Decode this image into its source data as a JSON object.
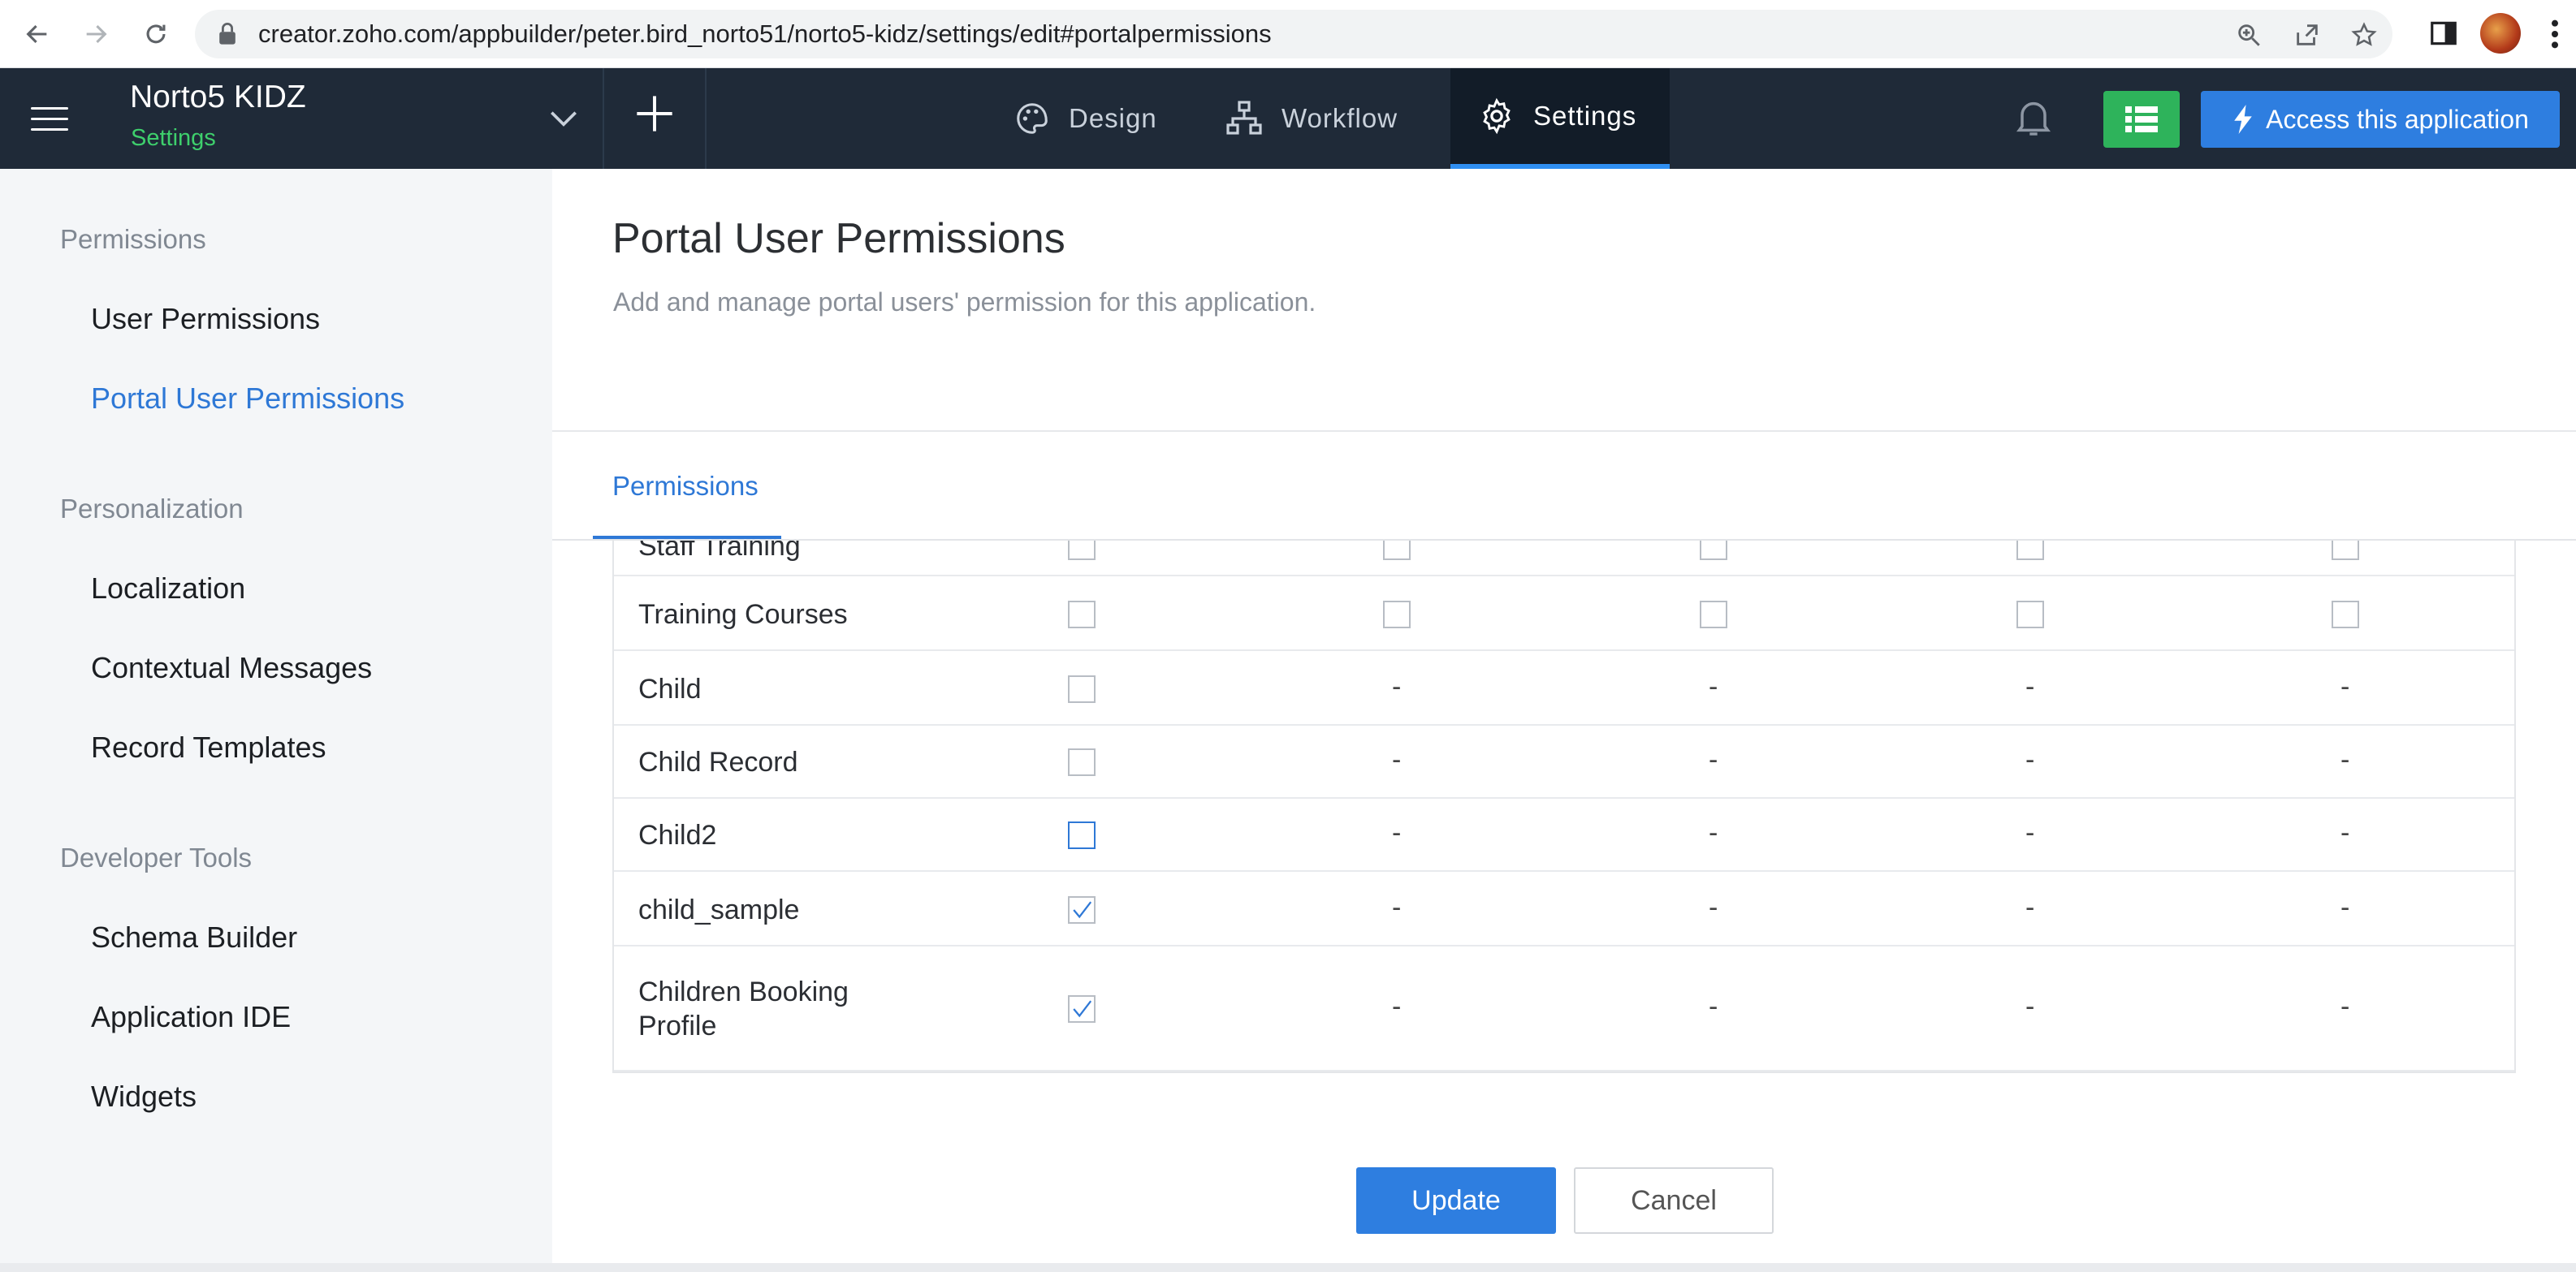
{
  "browser": {
    "url": "creator.zoho.com/appbuilder/peter.bird_norto51/norto5-kidz/settings/edit#portalpermissions"
  },
  "header": {
    "app_name": "Norto5 KIDZ",
    "app_section": "Settings",
    "tabs": [
      {
        "label": "Design",
        "icon": "palette-icon"
      },
      {
        "label": "Workflow",
        "icon": "workflow-icon"
      },
      {
        "label": "Settings",
        "icon": "gear-icon"
      }
    ],
    "active_tab": "Settings",
    "access_button": "Access this application"
  },
  "sidebar": {
    "sections": [
      {
        "title": "Permissions",
        "items": [
          "User Permissions",
          "Portal User Permissions"
        ]
      },
      {
        "title": "Personalization",
        "items": [
          "Localization",
          "Contextual Messages",
          "Record Templates"
        ]
      },
      {
        "title": "Developer Tools",
        "items": [
          "Schema Builder",
          "Application IDE",
          "Widgets"
        ]
      }
    ],
    "active_item": "Portal User Permissions"
  },
  "main": {
    "title": "Portal User Permissions",
    "description": "Add and manage portal users' permission for this application.",
    "tab": "Permissions",
    "rows": [
      {
        "label": "Staff Training",
        "cells": [
          "cb",
          "cb",
          "cb",
          "cb",
          "cb"
        ],
        "checked": false
      },
      {
        "label": "Training Courses",
        "cells": [
          "cb",
          "cb",
          "cb",
          "cb",
          "cb"
        ],
        "checked": false
      },
      {
        "label": "Child",
        "cells": [
          "cb",
          "-",
          "-",
          "-",
          "-"
        ],
        "checked": false
      },
      {
        "label": "Child Record",
        "cells": [
          "cb",
          "-",
          "-",
          "-",
          "-"
        ],
        "checked": false
      },
      {
        "label": "Child2",
        "cells": [
          "cb",
          "-",
          "-",
          "-",
          "-"
        ],
        "checked": false,
        "focused": true
      },
      {
        "label": "child_sample",
        "cells": [
          "cb",
          "-",
          "-",
          "-",
          "-"
        ],
        "checked": true
      },
      {
        "label": "Children Booking Profile",
        "cells": [
          "cb",
          "-",
          "-",
          "-",
          "-"
        ],
        "checked": true
      }
    ],
    "update_label": "Update",
    "cancel_label": "Cancel",
    "dash": "-"
  },
  "colors": {
    "header_bg": "#1f2a38",
    "accent": "#2e7ee0",
    "green": "#2eb35b",
    "sidebar_bg": "#f4f6f8"
  }
}
